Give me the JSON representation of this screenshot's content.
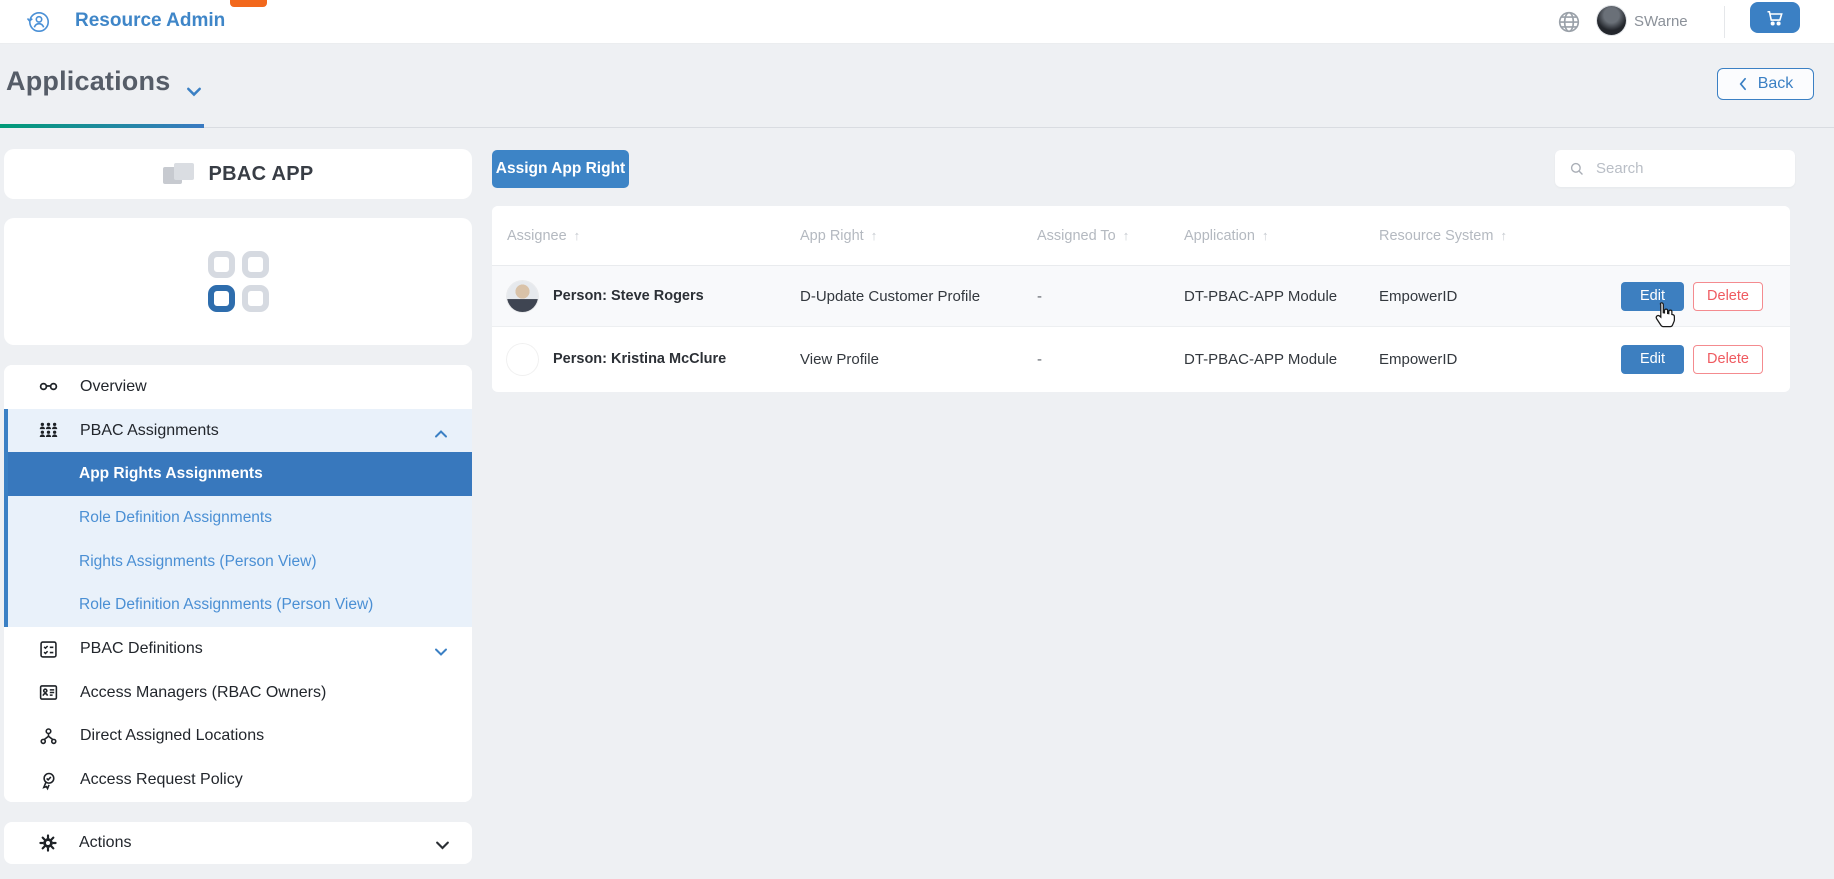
{
  "colors": {
    "accent_blue": "#3b80c4",
    "selected_item_blue": "#3878bd",
    "sub_item_bg": "#e9f1fa",
    "delete_red": "#ef5a60",
    "tab_gradient_start": "#009b77",
    "tab_gradient_end": "#3a7ac2",
    "badge_orange": "#f2681c",
    "page_background": "#eef0f3"
  },
  "topbar": {
    "app_title": "Resource Admin",
    "username": "SWarne"
  },
  "page_header": {
    "title": "Applications",
    "back_label": "Back"
  },
  "sidebar": {
    "app_name": "PBAC APP",
    "menu": {
      "overview": "Overview",
      "pbac_assignments": "PBAC Assignments",
      "sub_items": [
        "App Rights Assignments",
        "Role Definition Assignments",
        "Rights Assignments (Person View)",
        "Role Definition Assignments (Person View)"
      ],
      "selected_sub_item": "App Rights Assignments",
      "pbac_definitions": "PBAC Definitions",
      "access_managers": "Access Managers (RBAC Owners)",
      "direct_assigned_locations": "Direct Assigned Locations",
      "access_request_policy": "Access Request Policy"
    },
    "actions_label": "Actions"
  },
  "main": {
    "assign_button": "Assign App Right",
    "search_placeholder": "Search",
    "table": {
      "columns": [
        "Assignee",
        "App Right",
        "Assigned To",
        "Application",
        "Resource System"
      ],
      "rows": [
        {
          "assignee": "Person: Steve Rogers",
          "app_right": "D-Update Customer Profile",
          "assigned_to": "-",
          "application": "DT-PBAC-APP Module",
          "resource_system": "EmpowerID"
        },
        {
          "assignee": "Person: Kristina McClure",
          "app_right": "View Profile",
          "assigned_to": "-",
          "application": "DT-PBAC-APP Module",
          "resource_system": "EmpowerID"
        }
      ],
      "edit_label": "Edit",
      "delete_label": "Delete"
    }
  },
  "icons": {
    "sort_arrow": "↑"
  }
}
